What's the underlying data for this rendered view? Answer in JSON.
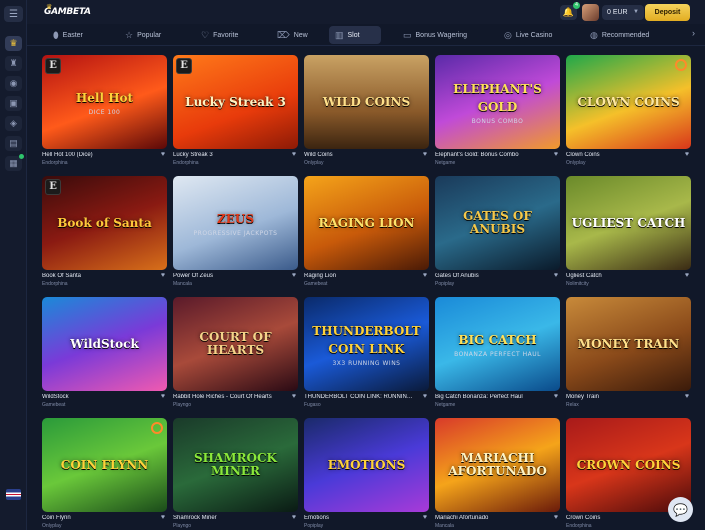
{
  "topbar": {
    "logo_text": "GAMBETA",
    "balance": "0 EUR",
    "deposit_label": "Deposit",
    "notification_count": "4"
  },
  "tabs": [
    {
      "label": "Easter",
      "icon": "egg-icon"
    },
    {
      "label": "Popular",
      "icon": "star-icon"
    },
    {
      "label": "Favorite",
      "icon": "heart-icon"
    },
    {
      "label": "New",
      "icon": "tag-icon"
    },
    {
      "label": "Slot",
      "icon": "slot-icon"
    },
    {
      "label": "Bonus Wagering",
      "icon": "wallet-icon"
    },
    {
      "label": "Live Casino",
      "icon": "chip-icon"
    },
    {
      "label": "Recommended",
      "icon": "thumb-icon"
    }
  ],
  "active_tab": "Slot",
  "games": [
    {
      "name": "Hell Hot 100 (Dice)",
      "provider": "Endorphina",
      "art": "Hell Hot",
      "art_sub": "DICE 100",
      "bg": "linear-gradient(160deg,#b31212,#ff5a1a 55%,#5a0808)",
      "fg": "#ffd23a",
      "badge": "E"
    },
    {
      "name": "Lucky Streak 3",
      "provider": "Endorphina",
      "art": "Lucky Streak 3",
      "art_sub": "",
      "bg": "linear-gradient(160deg,#ff7a1a,#e83b0b 60%,#8c1a06)",
      "fg": "#fff3c2",
      "badge": "E"
    },
    {
      "name": "Wild Coins",
      "provider": "Onlyplay",
      "art": "WILD COINS",
      "art_sub": "",
      "bg": "linear-gradient(180deg,#c9a264,#8a5a2a 60%,#3b2410)",
      "fg": "#ffe08a",
      "badge": ""
    },
    {
      "name": "Elephant's Gold: Bonus Combo",
      "provider": "Netgame",
      "art": "ELEPHANT'S GOLD",
      "art_sub": "BONUS COMBO",
      "bg": "linear-gradient(160deg,#5a2aa8,#c04ad8 50%,#f09a2a)",
      "fg": "#ffe15a",
      "badge": ""
    },
    {
      "name": "Clown Coins",
      "provider": "Onlyplay",
      "art": "CLOWN COINS",
      "art_sub": "",
      "bg": "linear-gradient(160deg,#1fa84a,#f5c02a 55%,#d8361a)",
      "fg": "#ffe8a0",
      "badge": "",
      "ring": true
    },
    {
      "name": "Book Of Santa",
      "provider": "Endorphina",
      "art": "Book of Santa",
      "art_sub": "",
      "bg": "linear-gradient(160deg,#3a0b0b,#8a1a12 50%,#d8701a)",
      "fg": "#ffc83a",
      "badge": "E"
    },
    {
      "name": "Power Of Zeus",
      "provider": "Mancala",
      "art": "ZEUS",
      "art_sub": "PROGRESSIVE JACKPOTS",
      "bg": "linear-gradient(160deg,#dfe8f2,#9eb8d8 55%,#3a5a8a)",
      "fg": "#e23a1a",
      "badge": ""
    },
    {
      "name": "Raging Lion",
      "provider": "Gamebeat",
      "art": "RAGING LION",
      "art_sub": "",
      "bg": "linear-gradient(160deg,#f5a41a,#c85a0a 55%,#4a1a06)",
      "fg": "#ffe36a",
      "badge": ""
    },
    {
      "name": "Gates Of Anubis",
      "provider": "Popiplay",
      "art": "GATES OF ANUBIS",
      "art_sub": "",
      "bg": "linear-gradient(160deg,#1a3a5a,#2a6a8a 50%,#0a1a2a)",
      "fg": "#f5c84a",
      "badge": ""
    },
    {
      "name": "Ugliest Catch",
      "provider": "Nolimitcity",
      "art": "UGLIEST CATCH",
      "art_sub": "",
      "bg": "linear-gradient(160deg,#6a8a2a,#a8b84a 50%,#3a2a14)",
      "fg": "#fff",
      "badge": ""
    },
    {
      "name": "WildStock",
      "provider": "Gamebeat",
      "art": "WildStock",
      "art_sub": "",
      "bg": "linear-gradient(160deg,#1a8ad8,#7a3ad8 50%,#f05ab0)",
      "fg": "#ffffff",
      "badge": ""
    },
    {
      "name": "Rabbit Hole Riches - Court Of Hearts",
      "provider": "Playngo",
      "art": "COURT OF HEARTS",
      "art_sub": "",
      "bg": "linear-gradient(160deg,#5a1a2a,#a84a3a 50%,#2a0a14)",
      "fg": "#f5d38a",
      "badge": ""
    },
    {
      "name": "THUNDERBOLT COIN LINK: RUNNING WINS",
      "provider": "Fugaso",
      "art": "THUNDERBOLT COIN LINK",
      "art_sub": "3X3 RUNNING WINS",
      "bg": "linear-gradient(160deg,#0a2a6a,#1a5ad8 50%,#0a1a3a)",
      "fg": "#ffd23a",
      "badge": ""
    },
    {
      "name": "Big Catch Bonanza: Perfect Haul",
      "provider": "Netgame",
      "art": "BIG CATCH",
      "art_sub": "BONANZA PERFECT HAUL",
      "bg": "linear-gradient(160deg,#1a8ad8,#3ab8e8 50%,#0a4a8a)",
      "fg": "#ffe15a",
      "badge": ""
    },
    {
      "name": "Money Train",
      "provider": "Relax",
      "art": "MONEY TRAIN",
      "art_sub": "",
      "bg": "linear-gradient(160deg,#c88a3a,#8a4a1a 55%,#3a1a0a)",
      "fg": "#ffe08a",
      "badge": ""
    },
    {
      "name": "Coin Flynn",
      "provider": "Onlyplay",
      "art": "COIN FLYNN",
      "art_sub": "",
      "bg": "linear-gradient(160deg,#2a9a3a,#6ac83a 50%,#1a4a1a)",
      "fg": "#ffd23a",
      "badge": "",
      "ring": true
    },
    {
      "name": "Shamrock Miner",
      "provider": "Playngo",
      "art": "SHAMROCK MINER",
      "art_sub": "",
      "bg": "linear-gradient(160deg,#1a3a2a,#2a6a3a 50%,#0a1a14)",
      "fg": "#8ae83a",
      "badge": ""
    },
    {
      "name": "Emotions",
      "provider": "Popiplay",
      "art": "EMOTIONS",
      "art_sub": "",
      "bg": "linear-gradient(160deg,#1a2a6a,#4a3ad8 50%,#a83ad8)",
      "fg": "#ffd23a",
      "badge": ""
    },
    {
      "name": "Mariachi Afortunado",
      "provider": "Mancala",
      "art": "MARIACHI AFORTUNADO",
      "art_sub": "",
      "bg": "linear-gradient(160deg,#d83a2a,#f5a41a 50%,#6a1a0a)",
      "fg": "#fff3c2",
      "badge": ""
    },
    {
      "name": "Crown Coins",
      "provider": "Endorphina",
      "art": "CROWN COINS",
      "art_sub": "",
      "bg": "linear-gradient(160deg,#a81a1a,#d8361a 50%,#4a0a0a)",
      "fg": "#ffd23a",
      "badge": ""
    }
  ]
}
